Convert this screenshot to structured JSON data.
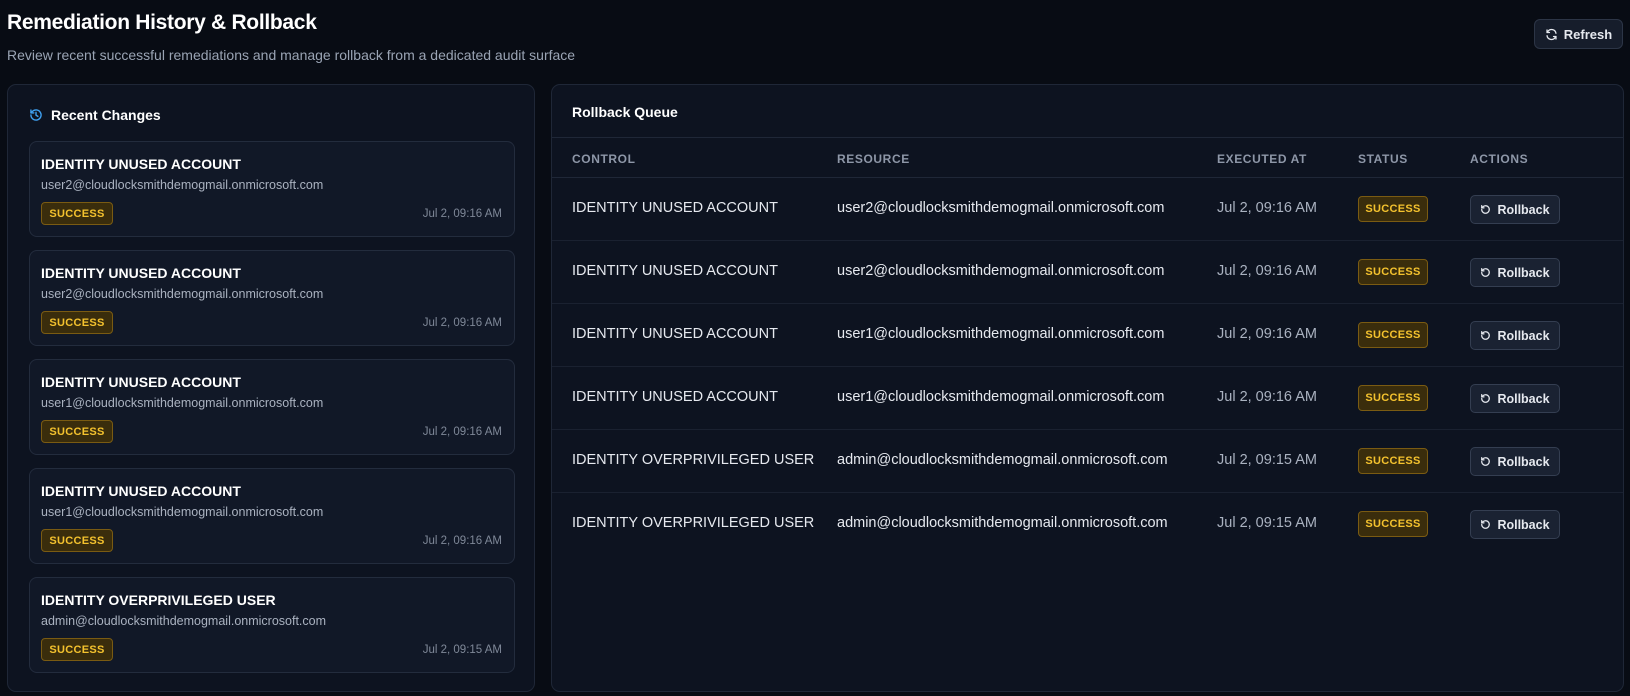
{
  "header": {
    "title": "Remediation History & Rollback",
    "subtitle": "Review recent successful remediations and manage rollback from a dedicated audit surface",
    "refresh_label": "Refresh"
  },
  "recent_changes": {
    "title": "Recent Changes",
    "items": [
      {
        "control": "IDENTITY UNUSED ACCOUNT",
        "resource": "user2@cloudlocksmithdemogmail.onmicrosoft.com",
        "status": "SUCCESS",
        "time": "Jul 2, 09:16 AM"
      },
      {
        "control": "IDENTITY UNUSED ACCOUNT",
        "resource": "user2@cloudlocksmithdemogmail.onmicrosoft.com",
        "status": "SUCCESS",
        "time": "Jul 2, 09:16 AM"
      },
      {
        "control": "IDENTITY UNUSED ACCOUNT",
        "resource": "user1@cloudlocksmithdemogmail.onmicrosoft.com",
        "status": "SUCCESS",
        "time": "Jul 2, 09:16 AM"
      },
      {
        "control": "IDENTITY UNUSED ACCOUNT",
        "resource": "user1@cloudlocksmithdemogmail.onmicrosoft.com",
        "status": "SUCCESS",
        "time": "Jul 2, 09:16 AM"
      },
      {
        "control": "IDENTITY OVERPRIVILEGED USER",
        "resource": "admin@cloudlocksmithdemogmail.onmicrosoft.com",
        "status": "SUCCESS",
        "time": "Jul 2, 09:15 AM"
      }
    ]
  },
  "rollback_queue": {
    "title": "Rollback Queue",
    "columns": [
      "CONTROL",
      "RESOURCE",
      "EXECUTED AT",
      "STATUS",
      "ACTIONS"
    ],
    "action_label": "Rollback",
    "rows": [
      {
        "control": "IDENTITY UNUSED ACCOUNT",
        "resource": "user2@cloudlocksmithdemogmail.onmicrosoft.com",
        "executed_at": "Jul 2, 09:16 AM",
        "status": "SUCCESS"
      },
      {
        "control": "IDENTITY UNUSED ACCOUNT",
        "resource": "user2@cloudlocksmithdemogmail.onmicrosoft.com",
        "executed_at": "Jul 2, 09:16 AM",
        "status": "SUCCESS"
      },
      {
        "control": "IDENTITY UNUSED ACCOUNT",
        "resource": "user1@cloudlocksmithdemogmail.onmicrosoft.com",
        "executed_at": "Jul 2, 09:16 AM",
        "status": "SUCCESS"
      },
      {
        "control": "IDENTITY UNUSED ACCOUNT",
        "resource": "user1@cloudlocksmithdemogmail.onmicrosoft.com",
        "executed_at": "Jul 2, 09:16 AM",
        "status": "SUCCESS"
      },
      {
        "control": "IDENTITY OVERPRIVILEGED USER",
        "resource": "admin@cloudlocksmithdemogmail.onmicrosoft.com",
        "executed_at": "Jul 2, 09:15 AM",
        "status": "SUCCESS"
      },
      {
        "control": "IDENTITY OVERPRIVILEGED USER",
        "resource": "admin@cloudlocksmithdemogmail.onmicrosoft.com",
        "executed_at": "Jul 2, 09:15 AM",
        "status": "SUCCESS"
      }
    ]
  },
  "colors": {
    "background": "#080c14",
    "panel": "#0d1320",
    "accent_icon": "#3fa0f0",
    "success_text": "#f4c22e",
    "success_bg": "#3a2d0c"
  },
  "icons": {
    "refresh": "refresh-icon",
    "history": "history-icon",
    "rollback": "undo-icon"
  }
}
